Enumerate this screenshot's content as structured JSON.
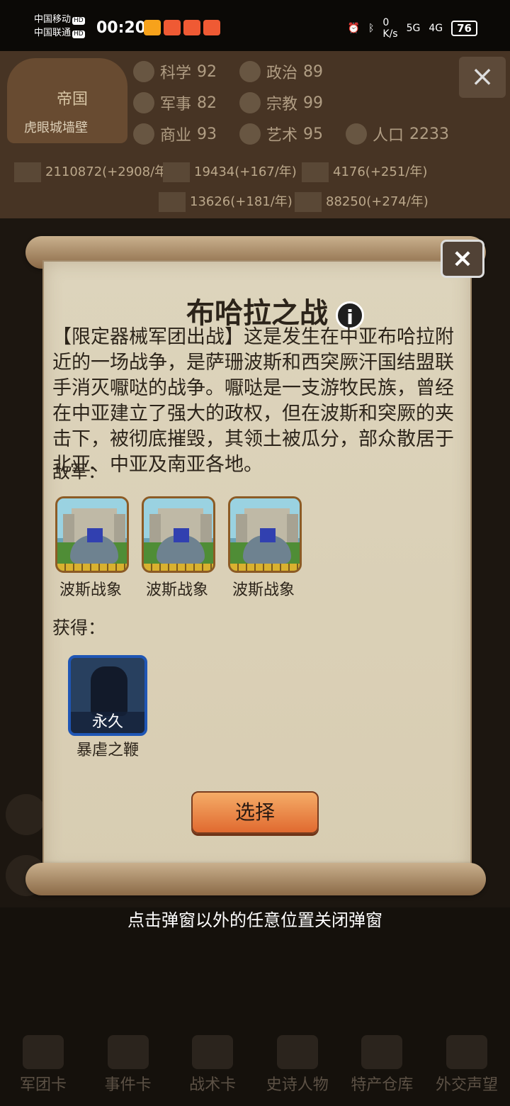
{
  "status_bar": {
    "carrier_1": "中国移动",
    "carrier_2": "中国联通",
    "hd_1": "HD",
    "hd_2": "HD",
    "time": "00:20",
    "network_speed_top": "0",
    "network_speed_bottom": "K/s",
    "signal_1": "5G",
    "signal_2": "4G",
    "battery": "76"
  },
  "background_panel": {
    "crest_title": "帝国",
    "crest_subtitle": "虎眼城墙壁",
    "stats": [
      {
        "label": "科学",
        "value": "92"
      },
      {
        "label": "政治",
        "value": "89"
      },
      {
        "label": "军事",
        "value": "82"
      },
      {
        "label": "宗教",
        "value": "99"
      },
      {
        "label": "商业",
        "value": "93"
      },
      {
        "label": "艺术",
        "value": "95"
      },
      {
        "label": "人口",
        "value": "2233"
      }
    ],
    "resources": [
      "2110872(+2908/年)",
      "19434(+167/年)",
      "4176(+251/年)",
      "13626(+181/年)",
      "88250(+274/年)"
    ]
  },
  "modal": {
    "title": "布哈拉之战",
    "info_icon": "i",
    "description": "【限定器械军团出战】这是发生在中亚布哈拉附近的一场战争，是萨珊波斯和西突厥汗国结盟联手消灭嚈哒的战争。嚈哒是一支游牧民族，曾经在中亚建立了强大的政权，但在波斯和突厥的夹击下，被彻底摧毁，其领土被瓜分，部众散居于北亚、中亚及南亚各地。",
    "enemy_label": "敌军：",
    "enemies": [
      "波斯战象",
      "波斯战象",
      "波斯战象"
    ],
    "reward_label": "获得：",
    "reward": {
      "badge": "永久",
      "name": "暴虐之鞭"
    },
    "choose_button": "选择",
    "close_label": "×"
  },
  "hint": "点击弹窗以外的任意位置关闭弹窗",
  "bottom_nav": [
    "军团卡",
    "事件卡",
    "战术卡",
    "史诗人物",
    "特产仓库",
    "外交声望"
  ]
}
